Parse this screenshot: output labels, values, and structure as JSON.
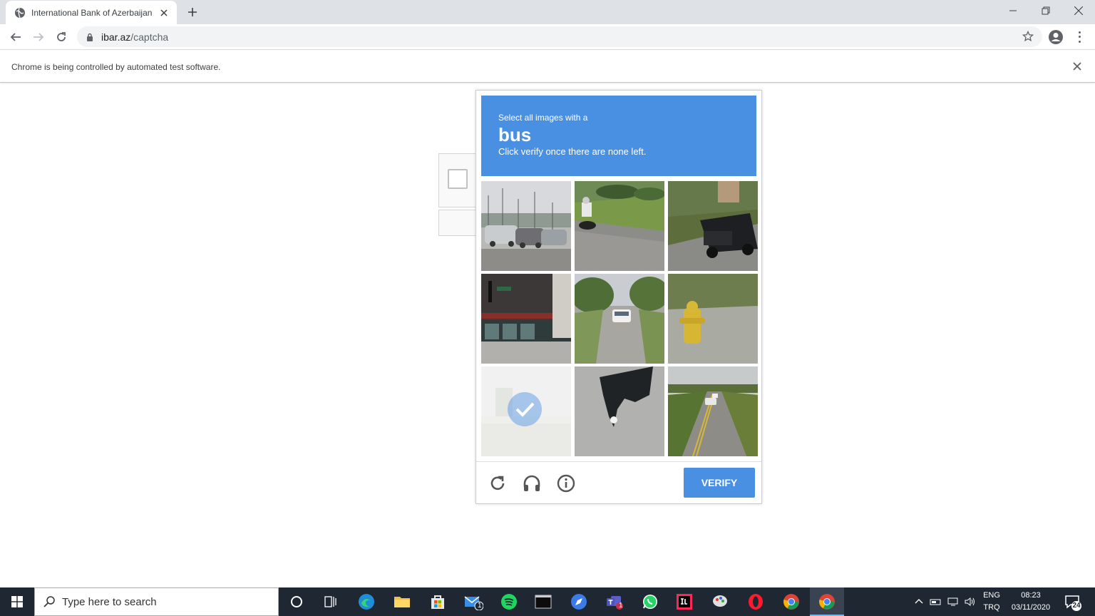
{
  "browser": {
    "tab_title": "International Bank of Azerbaijan",
    "url_host": "ibar.az",
    "url_path": "/captcha",
    "infobar_message": "Chrome is being controlled by automated test software."
  },
  "captcha": {
    "prompt_line1": "Select all images with a",
    "target": "bus",
    "prompt_line3": "Click verify once there are none left.",
    "verify_label": "VERIFY",
    "tiles": [
      {
        "index": 1,
        "content": "parking-lot-cars",
        "selected": false
      },
      {
        "index": 2,
        "content": "motorcycle-on-road",
        "selected": false
      },
      {
        "index": 3,
        "content": "black-suv",
        "selected": false
      },
      {
        "index": 4,
        "content": "street-corner-building",
        "selected": false
      },
      {
        "index": 5,
        "content": "car-on-road",
        "selected": false
      },
      {
        "index": 6,
        "content": "fire-hydrant",
        "selected": false
      },
      {
        "index": 7,
        "content": "faded-loading-tile",
        "selected": true
      },
      {
        "index": 8,
        "content": "closeup-object",
        "selected": false
      },
      {
        "index": 9,
        "content": "highway-with-car",
        "selected": false
      }
    ]
  },
  "taskbar": {
    "search_placeholder": "Type here to search",
    "lang_top": "ENG",
    "lang_bottom": "TRQ",
    "time": "08:23",
    "date": "03/11/2020",
    "notifications_count": "24",
    "mail_badge": "1",
    "teams_badge": "1"
  },
  "colors": {
    "captcha_blue": "#4a90e2",
    "taskbar_bg": "#1f2733"
  }
}
